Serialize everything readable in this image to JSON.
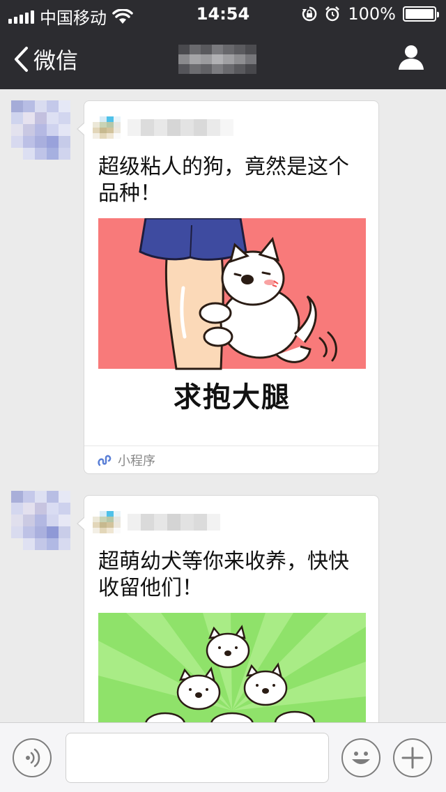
{
  "status_bar": {
    "carrier": "中国移动",
    "time": "14:54",
    "battery_percent": "100%",
    "battery_level": 1.0
  },
  "nav": {
    "back_label": "微信"
  },
  "messages": [
    {
      "title": "超级粘人的狗，竟然是这个品种！",
      "image_caption": "求抱大腿",
      "footer_label": "小程序"
    },
    {
      "title": "超萌幼犬等你来收养，快快收留他们！"
    }
  ],
  "colors": {
    "nav_background": "#2c2c30",
    "chat_background": "#ebebeb",
    "card_image_1_background": "#f87a7a",
    "card_image_2_background": "#8fe26a",
    "mini_program_icon": "#5a7fd6"
  },
  "icons": {
    "back": "chevron-left-icon",
    "profile": "person-icon",
    "voice": "voice-icon",
    "emoji": "emoji-icon",
    "add": "plus-icon",
    "mini_program": "mini-program-icon"
  }
}
